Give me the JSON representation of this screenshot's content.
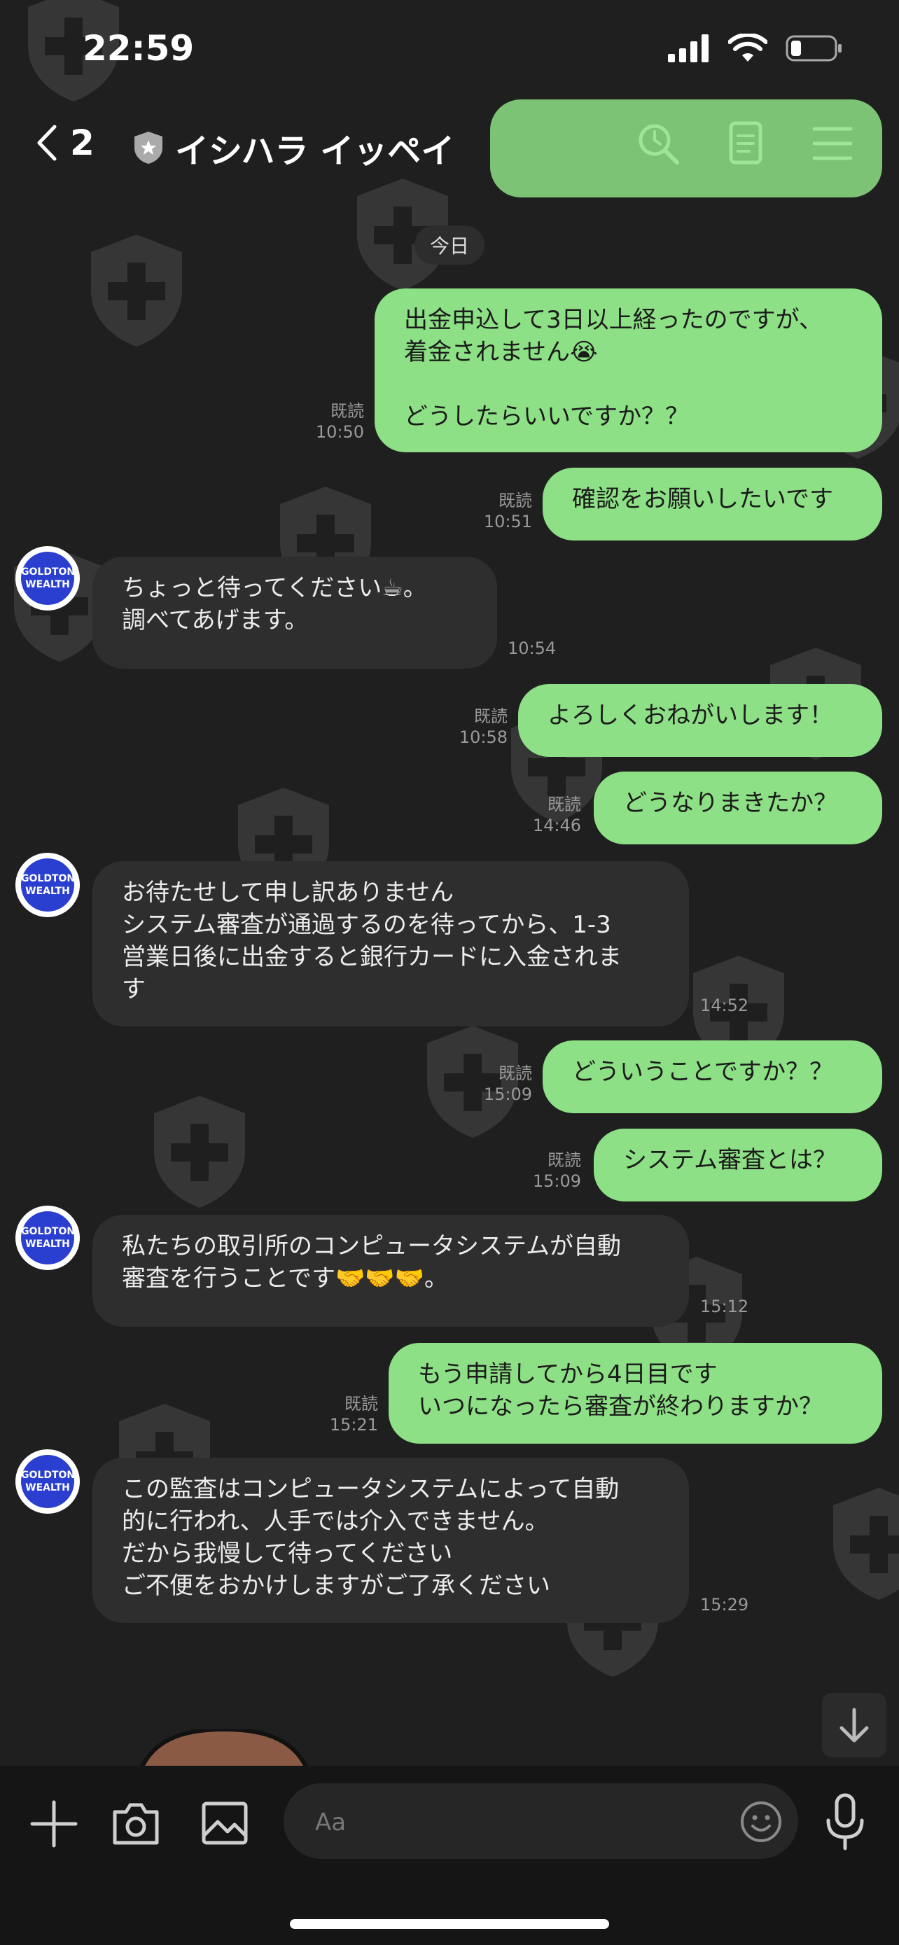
{
  "status": {
    "time": "22:59"
  },
  "header": {
    "back_count": "2",
    "contact_name": "イシハラ イッペイ"
  },
  "date_separator": "今日",
  "avatar_text": {
    "line1": "GOLDTON",
    "line2": "WEALTH"
  },
  "messages": [
    {
      "dir": "out",
      "lines": [
        "出金申込して3日以上経ったのですが、",
        "着金されません😭",
        "",
        "どうしたらいいですか？？"
      ],
      "read": "既読",
      "time": "10:50"
    },
    {
      "dir": "out",
      "lines": [
        "確認をお願いしたいです"
      ],
      "read": "既読",
      "time": "10:51"
    },
    {
      "dir": "in",
      "lines": [
        "ちょっと待ってください☕。",
        "調べてあげます。"
      ],
      "time": "10:54"
    },
    {
      "dir": "out",
      "lines": [
        "よろしくおねがいします！"
      ],
      "read": "既読",
      "time": "10:58"
    },
    {
      "dir": "out",
      "lines": [
        "どうなりまきたか？"
      ],
      "read": "既読",
      "time": "14:46"
    },
    {
      "dir": "in",
      "lines": [
        "お待たせして申し訳ありません",
        "システム審査が通過するのを待ってから、1-3",
        "営業日後に出金すると銀行カードに入金されま",
        "す"
      ],
      "time": "14:52"
    },
    {
      "dir": "out",
      "lines": [
        "どういうことですか？？"
      ],
      "read": "既読",
      "time": "15:09"
    },
    {
      "dir": "out",
      "lines": [
        "システム審査とは？"
      ],
      "read": "既読",
      "time": "15:09"
    },
    {
      "dir": "in",
      "lines": [
        "私たちの取引所のコンピュータシステムが自動",
        "審査を行うことです🤝🤝🤝。"
      ],
      "time": "15:12"
    },
    {
      "dir": "out",
      "lines": [
        "もう申請してから4日目です",
        "いつになったら審査が終わりますか？"
      ],
      "read": "既読",
      "time": "15:21"
    },
    {
      "dir": "in",
      "lines": [
        "この監査はコンピュータシステムによって自動",
        "的に行われ、人手では介入できません。",
        "だから我慢して待ってください",
        "ご不便をおかけしますがご了承ください"
      ],
      "time": "15:29"
    }
  ],
  "composer": {
    "placeholder": "Aa"
  },
  "colors": {
    "outgoing": "#8de085",
    "incoming": "#2e2e2e",
    "background": "#1f1f1f"
  },
  "icons": [
    "back-chevron-icon",
    "shield-badge-icon",
    "search-icon",
    "notes-icon",
    "menu-icon",
    "scroll-down-icon",
    "plus-icon",
    "camera-icon",
    "image-icon",
    "emoji-icon",
    "mic-icon"
  ]
}
